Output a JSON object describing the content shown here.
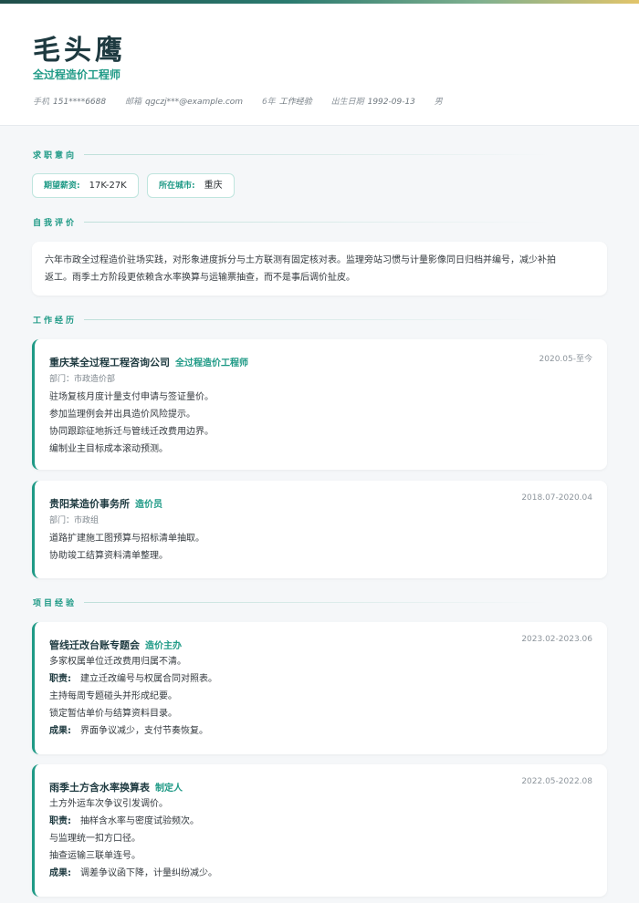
{
  "header": {
    "name": "毛头鹰",
    "title": "全过程造价工程师",
    "contacts": {
      "phone_label": "手机",
      "phone": "151****6688",
      "email_label": "邮箱",
      "email": "qgczj***@example.com",
      "exp_years": "6年",
      "exp_label": "工作经验",
      "birth_label": "出生日期",
      "birth": "1992-09-13",
      "gender": "男"
    }
  },
  "intent": {
    "section_title": "求职意向",
    "salary_label": "期望薪资:",
    "salary": "17K-27K",
    "city_label": "所在城市:",
    "city": "重庆"
  },
  "self_eval": {
    "section_title": "自我评价",
    "line1": "六年市政全过程造价驻场实践，对形象进度拆分与土方联测有固定核对表。监理旁站习惯与计量影像同日归档并编号，减少补拍",
    "line2": "返工。雨季土方阶段更依赖含水率换算与运输票抽查，而不是事后调价扯皮。"
  },
  "work": {
    "section_title": "工作经历",
    "items": [
      {
        "org": "重庆某全过程工程咨询公司",
        "role": "全过程造价工程师",
        "date": "2020.05-至今",
        "dept": "部门：市政造价部",
        "lines": [
          "驻场复核月度计量支付申请与签证量价。",
          "参加监理例会并出具造价风险提示。",
          "协同跟踪征地拆迁与管线迁改费用边界。",
          "编制业主目标成本滚动预测。"
        ]
      },
      {
        "org": "贵阳某造价事务所",
        "role": "造价员",
        "date": "2018.07-2020.04",
        "dept": "部门：市政组",
        "lines": [
          "道路扩建施工图预算与招标清单抽取。",
          "协助竣工结算资料清单整理。"
        ]
      }
    ]
  },
  "projects": {
    "section_title": "项目经验",
    "duty_label": "职责:",
    "result_label": "成果:",
    "items": [
      {
        "name": "管线迁改台账专题会",
        "role": "造价主办",
        "date": "2023.02-2023.06",
        "desc": "多家权属单位迁改费用归属不清。",
        "duty": "建立迁改编号与权属合同对照表。",
        "extra": [
          "主持每周专题碰头并形成纪要。",
          "锁定暂估单价与结算资料目录。"
        ],
        "result": "界面争议减少，支付节奏恢复。"
      },
      {
        "name": "雨季土方含水率换算表",
        "role": "制定人",
        "date": "2022.05-2022.08",
        "desc": "土方外运车次争议引发调价。",
        "duty": "抽样含水率与密度试验频次。",
        "extra": [
          "与监理统一扣方口径。",
          "抽查运输三联单连号。"
        ],
        "result": "调差争议函下降，计量纠纷减少。"
      }
    ]
  }
}
